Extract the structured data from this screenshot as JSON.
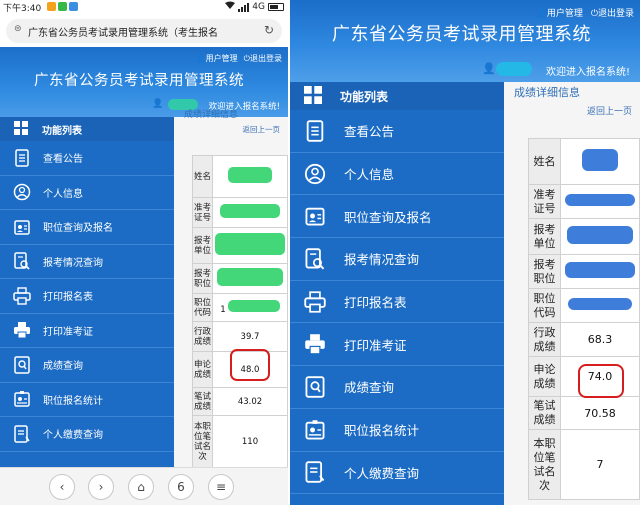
{
  "left": {
    "status": {
      "time": "下午3:40",
      "network": "4G"
    },
    "url": "广东省公务员考试录用管理系统（考生报名",
    "banner": {
      "user_manage": "用户管理",
      "logout": "退出登录",
      "title": "广东省公务员考试录用管理系统",
      "welcome": "欢迎进入报名系统!"
    },
    "sidebar": {
      "header": "功能列表",
      "items": [
        {
          "label": "查看公告"
        },
        {
          "label": "个人信息"
        },
        {
          "label": "职位查询及报名"
        },
        {
          "label": "报考情况查询"
        },
        {
          "label": "打印报名表"
        },
        {
          "label": "打印准考证"
        },
        {
          "label": "成绩查询"
        },
        {
          "label": "职位报名统计"
        },
        {
          "label": "个人缴费查询"
        }
      ]
    },
    "content": {
      "page_title": "成绩详细信息",
      "back": "返回上一页",
      "rows": [
        {
          "label": "姓名",
          "value": ""
        },
        {
          "label": "准考证号",
          "value": ""
        },
        {
          "label": "报考单位",
          "value": ""
        },
        {
          "label": "报考职位",
          "value": ""
        },
        {
          "label": "职位代码",
          "value": "1"
        },
        {
          "label": "行政成绩",
          "value": "39.7"
        },
        {
          "label": "申论成绩",
          "value": "48.0"
        },
        {
          "label": "笔试成绩",
          "value": "43.02"
        },
        {
          "label": "本职位笔试名次",
          "value": "110"
        }
      ]
    },
    "nav": {
      "back": "‹",
      "forward": "›",
      "home": "⌂",
      "tabs": "6",
      "menu": "≡"
    }
  },
  "right": {
    "banner": {
      "user_manage": "用户管理",
      "logout": "退出登录",
      "title": "广东省公务员考试录用管理系统",
      "welcome": "欢迎进入报名系统!"
    },
    "sidebar": {
      "header": "功能列表",
      "items": [
        {
          "label": "查看公告"
        },
        {
          "label": "个人信息"
        },
        {
          "label": "职位查询及报名"
        },
        {
          "label": "报考情况查询"
        },
        {
          "label": "打印报名表"
        },
        {
          "label": "打印准考证"
        },
        {
          "label": "成绩查询"
        },
        {
          "label": "职位报名统计"
        },
        {
          "label": "个人缴费查询"
        }
      ]
    },
    "content": {
      "page_title": "成绩详细信息",
      "back": "返回上一页",
      "rows": [
        {
          "label": "姓名",
          "value": ""
        },
        {
          "label": "准考证号",
          "value": ""
        },
        {
          "label": "报考单位",
          "value": ""
        },
        {
          "label": "报考职位",
          "value": ""
        },
        {
          "label": "职位代码",
          "value": ""
        },
        {
          "label": "行政成绩",
          "value": "68.3"
        },
        {
          "label": "申论成绩",
          "value": "74.0"
        },
        {
          "label": "笔试成绩",
          "value": "70.58"
        },
        {
          "label": "本职位笔试名次",
          "value": "7"
        }
      ]
    }
  },
  "colors": {
    "sidebar": "#1c6cc5",
    "banner": "#2f88e0",
    "highlight": "#d61e1e"
  }
}
